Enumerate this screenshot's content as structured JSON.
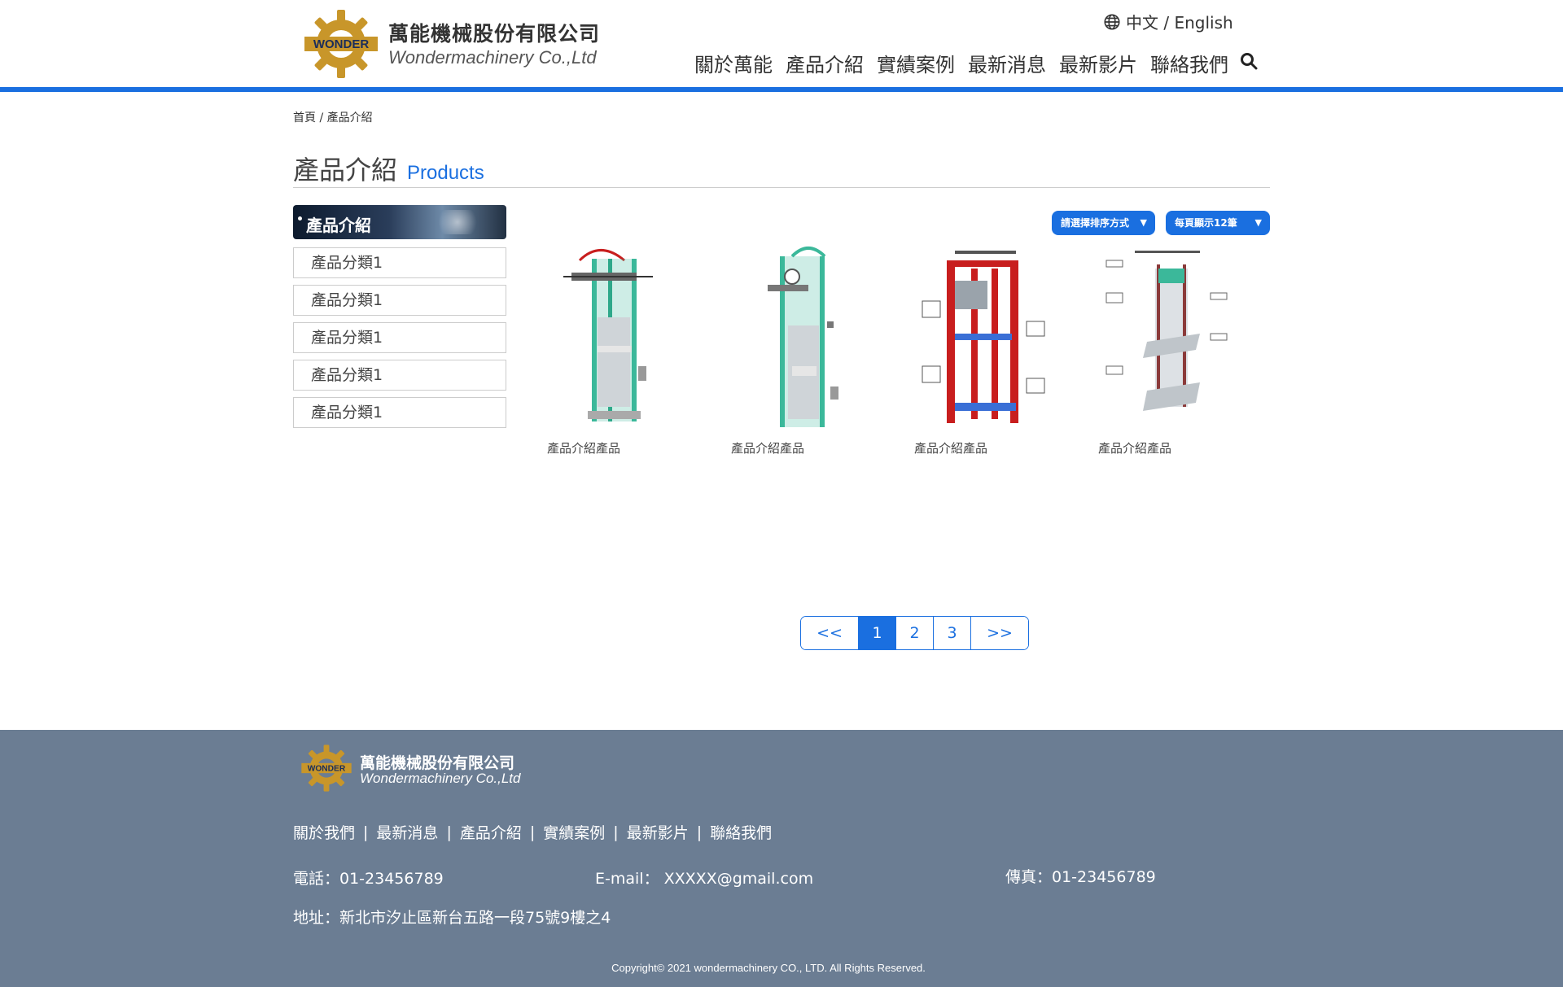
{
  "header": {
    "brand_cn": "萬能機械股份有限公司",
    "brand_en": "Wondermachinery Co.,Ltd",
    "logo_text": "WONDER",
    "lang_label": "中文 / English",
    "nav": [
      "關於萬能",
      "產品介紹",
      "實績案例",
      "最新消息",
      "最新影片",
      "聯絡我們"
    ]
  },
  "breadcrumb": {
    "home": "首頁",
    "sep": " / ",
    "current": "產品介紹"
  },
  "page_title": {
    "cn": "產品介紹",
    "en": "Products"
  },
  "sidebar": {
    "title": "產品介紹",
    "items": [
      "產品分類1",
      "產品分類1",
      "產品分類1",
      "產品分類1",
      "產品分類1"
    ]
  },
  "controls": {
    "sort_label": "請選擇排序方式",
    "per_page_label": "每頁顯示12筆"
  },
  "products": [
    {
      "name": "產品介紹產品"
    },
    {
      "name": "產品介紹產品"
    },
    {
      "name": "產品介紹產品"
    },
    {
      "name": "產品介紹產品"
    }
  ],
  "pagination": {
    "prev": "<<",
    "pages": [
      "1",
      "2",
      "3"
    ],
    "next": ">>",
    "current": "1"
  },
  "footer": {
    "brand_cn": "萬能機械股份有限公司",
    "brand_en": "Wondermachinery Co.,Ltd",
    "nav": [
      "關於我們",
      "最新消息",
      "產品介紹",
      "實績案例",
      "最新影片",
      "聯絡我們"
    ],
    "tel": "電話：01-23456789",
    "email": "E-mail： XXXXX@gmail.com",
    "fax": "傳真：01-23456789",
    "address": "地址：新北市汐止區新台五路一段75號9樓之4",
    "copyright": "Copyright© 2021 wondermachinery CO., LTD. All Rights Reserved."
  },
  "colors": {
    "accent": "#1a6fe0",
    "footer_bg": "#6b7d93",
    "logo_gold": "#c8962a",
    "product_green": "#3bb89a",
    "product_red": "#c81e1e"
  }
}
